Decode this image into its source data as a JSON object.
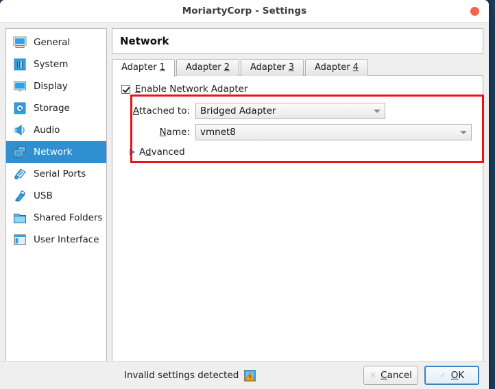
{
  "window": {
    "title": "MoriartyCorp - Settings",
    "close_button": "close-button",
    "accent_selected": "#2f8fd0",
    "annotation_color": "#ee1111"
  },
  "sidebar": {
    "items": [
      {
        "label": "General",
        "icon": "monitor-icon",
        "selected": false
      },
      {
        "label": "System",
        "icon": "chip-icon",
        "selected": false
      },
      {
        "label": "Display",
        "icon": "display-icon",
        "selected": false
      },
      {
        "label": "Storage",
        "icon": "harddisk-icon",
        "selected": false
      },
      {
        "label": "Audio",
        "icon": "speaker-icon",
        "selected": false
      },
      {
        "label": "Network",
        "icon": "network-icon",
        "selected": true
      },
      {
        "label": "Serial Ports",
        "icon": "serial-port-icon",
        "selected": false
      },
      {
        "label": "USB",
        "icon": "usb-icon",
        "selected": false
      },
      {
        "label": "Shared Folders",
        "icon": "folder-icon",
        "selected": false
      },
      {
        "label": "User Interface",
        "icon": "user-interface-icon",
        "selected": false
      }
    ]
  },
  "page": {
    "title": "Network",
    "tabs": [
      {
        "pre": "Adapter ",
        "mnemonic": "1",
        "active": true
      },
      {
        "pre": "Adapter ",
        "mnemonic": "2",
        "active": false
      },
      {
        "pre": "Adapter ",
        "mnemonic": "3",
        "active": false
      },
      {
        "pre": "Adapter ",
        "mnemonic": "4",
        "active": false
      }
    ]
  },
  "form": {
    "enable_adapter": {
      "checked": true,
      "mnemonic": "E",
      "rest": "nable Network Adapter"
    },
    "attached_to": {
      "label_mnemonic": "A",
      "label_rest": "ttached to:",
      "value": "Bridged Adapter"
    },
    "name": {
      "label_pre": "",
      "label_mnemonic": "N",
      "label_rest": "ame:",
      "value": "vmnet8"
    },
    "advanced": {
      "pre": "A",
      "mnemonic": "d",
      "rest": "vanced",
      "expanded": false
    }
  },
  "footer": {
    "status_text": "Invalid settings detected",
    "status_icon": "warning-icon",
    "cancel": {
      "icon": "x-icon",
      "pre": "",
      "mnemonic": "C",
      "rest": "ancel"
    },
    "ok": {
      "icon": "check-icon",
      "pre": "",
      "mnemonic": "O",
      "rest": "K"
    }
  }
}
